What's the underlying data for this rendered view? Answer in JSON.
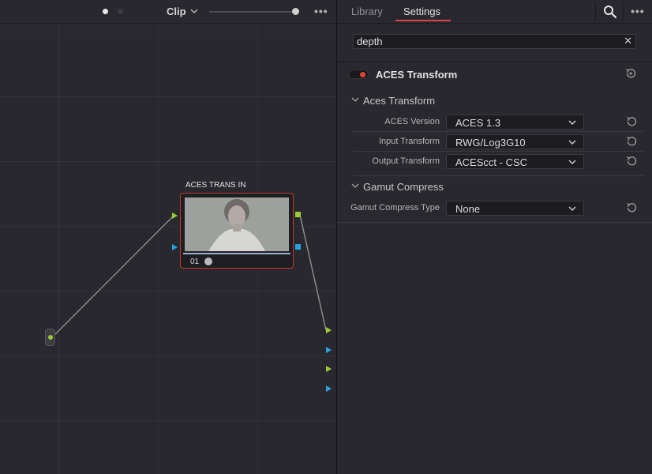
{
  "node_editor": {
    "mode_label": "Clip",
    "node": {
      "label": "ACES TRANS IN",
      "number": "01"
    }
  },
  "panel": {
    "tabs": [
      {
        "label": "Library",
        "active": false
      },
      {
        "label": "Settings",
        "active": true
      }
    ],
    "search": {
      "value": "depth",
      "placeholder": ""
    },
    "effect": {
      "title": "ACES Transform",
      "enabled": true
    },
    "sections": [
      {
        "title": "Aces Transform",
        "params": [
          {
            "label": "ACES Version",
            "value": "ACES 1.3"
          },
          {
            "label": "Input Transform",
            "value": "RWG/Log3G10"
          },
          {
            "label": "Output Transform",
            "value": "ACEScct - CSC"
          }
        ]
      },
      {
        "title": "Gamut Compress",
        "params": [
          {
            "label": "Gamut Compress Type",
            "value": "None"
          }
        ]
      }
    ]
  },
  "colors": {
    "accent_red": "#e04545",
    "node_border": "#c0392b",
    "port_green": "#9acd32",
    "port_blue": "#29a3e0",
    "background": "#28282e"
  },
  "icons": [
    "chevron-down-icon",
    "search-icon",
    "more-options-icon",
    "close-icon",
    "reset-icon",
    "fx-icon"
  ]
}
